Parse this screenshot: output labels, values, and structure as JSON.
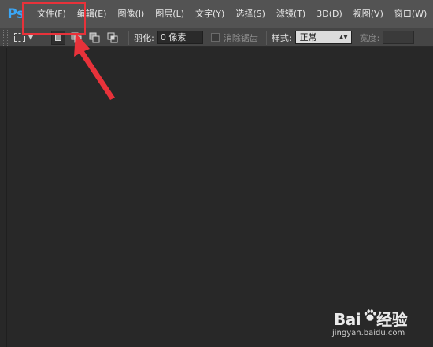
{
  "app": {
    "logo": "Ps"
  },
  "menu": [
    "文件(F)",
    "编辑(E)",
    "图像(I)",
    "图层(L)",
    "文字(Y)",
    "选择(S)",
    "滤镜(T)",
    "3D(D)",
    "视图(V)",
    "窗口(W)"
  ],
  "options": {
    "feather_label": "羽化:",
    "feather_value": "0 像素",
    "antialias_label": "消除锯齿",
    "style_label": "样式:",
    "style_value": "正常",
    "width_label": "宽度:"
  },
  "annotation": {
    "highlight_color": "#e8323a"
  },
  "watermark": {
    "brand_left": "Bai",
    "brand_right": "经验",
    "url": "jingyan.baidu.com"
  },
  "icons": [
    "rect-marquee-icon",
    "new-selection-icon",
    "add-selection-icon",
    "subtract-selection-icon",
    "intersect-selection-icon",
    "paw-icon"
  ]
}
